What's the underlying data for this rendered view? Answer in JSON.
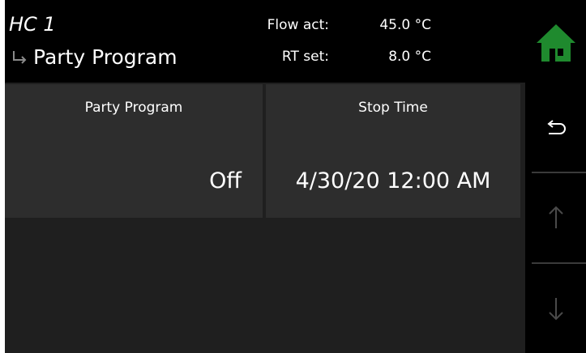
{
  "header": {
    "circuit": "HC 1",
    "subtitle": "Party Program",
    "flow_label": "Flow act:",
    "flow_value": "45.0 °C",
    "rt_label": "RT set:",
    "rt_value": "8.0 °C"
  },
  "tiles": [
    {
      "title": "Party Program",
      "value": "Off"
    },
    {
      "title": "Stop Time",
      "value": "4/30/20 12:00 AM"
    }
  ],
  "nav": {
    "home_icon": "home-icon",
    "back_icon": "back-arrow-icon",
    "up_icon": "arrow-up-icon",
    "down_icon": "arrow-down-icon"
  },
  "colors": {
    "background": "#000000",
    "content_background": "#1f1f1f",
    "tile_background": "#2d2d2d",
    "home_green": "#1f8a2e",
    "text": "#ffffff",
    "disabled_icon": "#4a4a4a"
  }
}
